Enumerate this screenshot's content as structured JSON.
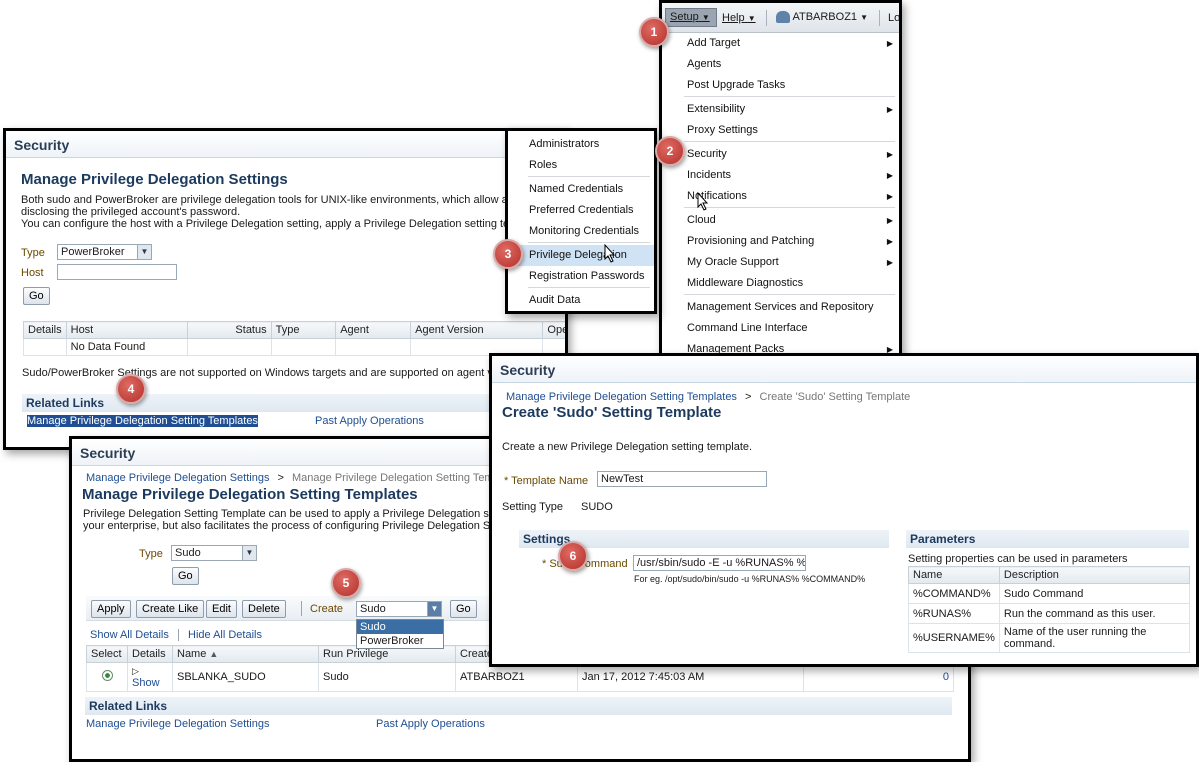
{
  "setup_menu": {
    "topbar": {
      "setup": "Setup",
      "help": "Help",
      "user": "ATBARBOZ1",
      "logout": "Lo"
    },
    "items": [
      {
        "label": "Add Target",
        "sub": true
      },
      {
        "label": "Agents",
        "sub": false
      },
      {
        "label": "Post Upgrade Tasks",
        "sub": false
      },
      {
        "sep": true
      },
      {
        "label": "Extensibility",
        "sub": true
      },
      {
        "label": "Proxy Settings",
        "sub": false
      },
      {
        "sep": true
      },
      {
        "label": "Security",
        "sub": true
      },
      {
        "label": "Incidents",
        "sub": true
      },
      {
        "label": "Notifications",
        "sub": true
      },
      {
        "sep": true
      },
      {
        "label": "Cloud",
        "sub": true
      },
      {
        "label": "Provisioning and Patching",
        "sub": true
      },
      {
        "label": "My Oracle Support",
        "sub": true
      },
      {
        "label": "Middleware Diagnostics",
        "sub": false
      },
      {
        "sep": true
      },
      {
        "label": "Management Services and Repository",
        "sub": false
      },
      {
        "label": "Command Line Interface",
        "sub": false
      },
      {
        "label": "Management Packs",
        "sub": true
      }
    ]
  },
  "security_submenu": {
    "items": [
      "Administrators",
      "Roles",
      "Named Credentials",
      "Preferred Credentials",
      "Monitoring Credentials",
      "Privilege Delegation",
      "Registration Passwords",
      "Audit Data"
    ]
  },
  "panel_settings": {
    "section": "Security",
    "heading": "Manage Privilege Delegation Settings",
    "desc1": "Both sudo and PowerBroker are privilege delegation tools for UNIX-like environments, which allow an",
    "desc2": "disclosing the privileged account's password.",
    "desc3": "You can configure the host with a Privilege Delegation setting, apply a Privilege Delegation setting ter",
    "type_label": "Type",
    "type_value": "PowerBroker",
    "host_label": "Host",
    "go": "Go",
    "columns": [
      "Details",
      "Host",
      "Status",
      "Type",
      "Agent",
      "Agent Version",
      "Opera"
    ],
    "no_data": "No Data Found",
    "note": "Sudo/PowerBroker Settings are not supported on Windows targets and are supported on agent ve",
    "related_title": "Related Links",
    "link1": "Manage Privilege Delegation Setting Templates",
    "link2": "Past Apply Operations"
  },
  "panel_templates": {
    "section": "Security",
    "breadcrumb1": "Manage Privilege Delegation Settings",
    "breadcrumb_sep": ">",
    "breadcrumb2": "Manage Privilege Delegation Setting Templa",
    "heading": "Manage Privilege Delegation Setting Templates",
    "desc1": "Privilege Delegation Setting Template can be used to apply a Privilege Delegation sett",
    "desc2": "your enterprise, but also facilitates the process of configuring Privilege Delegation Se",
    "type_label": "Type",
    "type_value": "Sudo",
    "go": "Go",
    "toolbar": {
      "apply": "Apply",
      "create_like": "Create Like",
      "edit": "Edit",
      "delete": "Delete",
      "create": "Create",
      "create_value": "Sudo",
      "go": "Go"
    },
    "dropdown_options": [
      "Sudo",
      "PowerBroker"
    ],
    "show_all": "Show All Details",
    "hide_all": "Hide All Details",
    "columns": [
      "Select",
      "Details",
      "Name",
      "Run Privilege",
      "Create"
    ],
    "row": {
      "details": "Show",
      "name": "SBLANKA_SUDO",
      "run_privilege": "Sudo",
      "created_by": "ATBARBOZ1",
      "date": "Jan 17, 2012 7:45:03 AM",
      "count": "0"
    },
    "related_title": "Related Links",
    "link1": "Manage Privilege Delegation Settings",
    "link2": "Past Apply Operations"
  },
  "panel_create": {
    "section": "Security",
    "breadcrumb1": "Manage Privilege Delegation Setting Templates",
    "breadcrumb_sep": ">",
    "breadcrumb2": "Create 'Sudo' Setting Template",
    "heading": "Create 'Sudo' Setting Template",
    "desc": "Create a new Privilege Delegation setting template.",
    "template_name_label": "* Template Name",
    "template_name_value": "NewTest",
    "setting_type_label": "Setting Type",
    "setting_type_value": "SUDO",
    "settings_title": "Settings",
    "sudo_label_a": "* Su",
    "sudo_label_b": "ommand",
    "sudo_value": "/usr/sbin/sudo -E -u %RUNAS% %",
    "example": "For eg. /opt/sudo/bin/sudo -u %RUNAS% %COMMAND%",
    "params_title": "Parameters",
    "params_desc": "Setting properties can be used in parameters",
    "params_cols": [
      "Name",
      "Description"
    ],
    "params_rows": [
      {
        "name": "%COMMAND%",
        "desc": "Sudo Command"
      },
      {
        "name": "%RUNAS%",
        "desc": "Run the command as this user."
      },
      {
        "name": "%USERNAME%",
        "desc": "Name of the user running the command."
      }
    ]
  },
  "badges": [
    "1",
    "2",
    "3",
    "4",
    "5",
    "6"
  ]
}
